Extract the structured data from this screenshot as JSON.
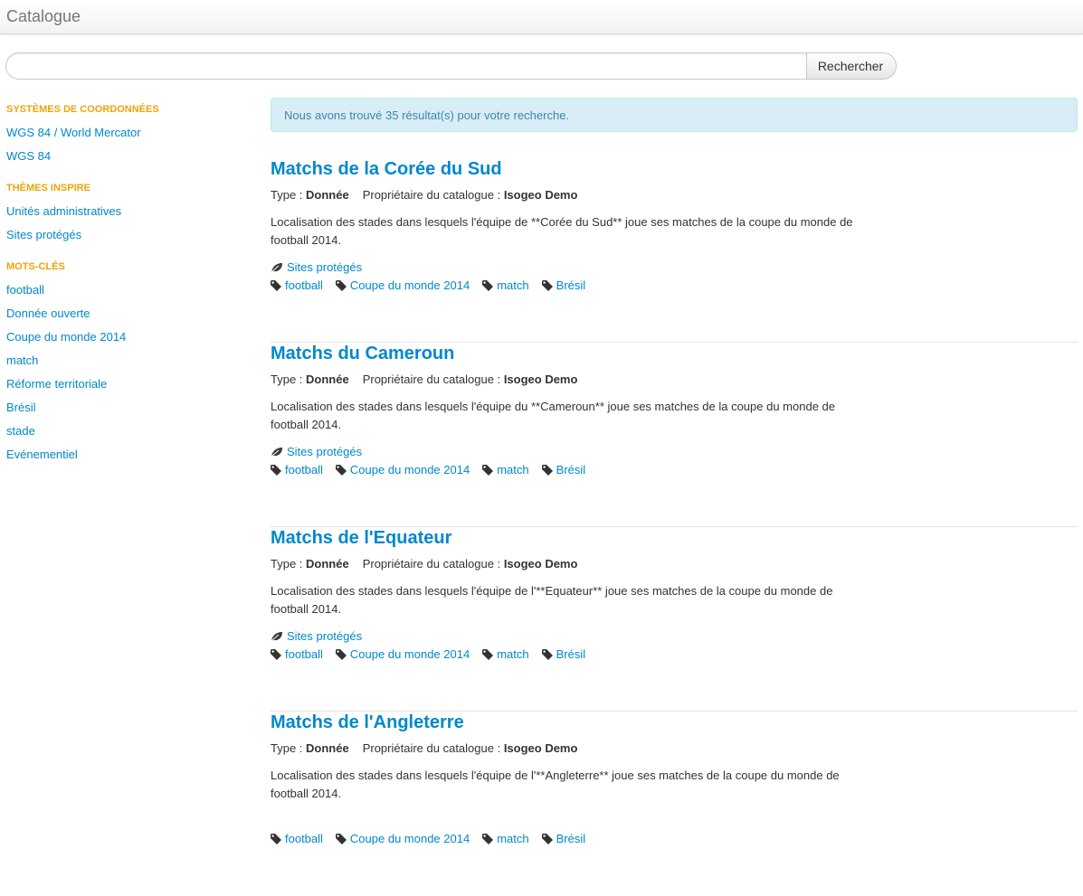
{
  "app": {
    "brand": "Catalogue"
  },
  "search": {
    "value": "",
    "placeholder": "",
    "button_label": "Rechercher"
  },
  "sidebar": {
    "facets": [
      {
        "heading": "Systèmes de coordonnées",
        "items": [
          "WGS 84 / World Mercator",
          "WGS 84"
        ]
      },
      {
        "heading": "Thèmes INSPIRE",
        "items": [
          "Unités administratives",
          "Sites protégés"
        ]
      },
      {
        "heading": "Mots-clés",
        "items": [
          "football",
          "Donnée ouverte",
          "Coupe du monde 2014",
          "match",
          "Réforme territoriale",
          "Brésil",
          "stade",
          "Evénementiel"
        ]
      }
    ]
  },
  "results_alert": "Nous avons trouvé 35 résultat(s) pour votre recherche.",
  "labels": {
    "type_label": "Type : ",
    "owner_label": "Propriétaire du catalogue : "
  },
  "results": [
    {
      "title": "Matchs de la Corée du Sud",
      "type": "Donnée",
      "owner": "Isogeo Demo",
      "description": "Localisation des stades dans lesquels l'équipe de **Corée du Sud** joue ses matches de la coupe du monde de football 2014.",
      "theme": "Sites protégés",
      "tags": [
        "football",
        "Coupe du monde 2014",
        "match",
        "Brésil"
      ]
    },
    {
      "title": "Matchs du Cameroun",
      "type": "Donnée",
      "owner": "Isogeo Demo",
      "description": "Localisation des stades dans lesquels l'équipe du **Cameroun** joue ses matches de la coupe du monde de football 2014.",
      "theme": "Sites protégés",
      "tags": [
        "football",
        "Coupe du monde 2014",
        "match",
        "Brésil"
      ]
    },
    {
      "title": "Matchs de l'Equateur",
      "type": "Donnée",
      "owner": "Isogeo Demo",
      "description": "Localisation des stades dans lesquels l'équipe de l'**Equateur** joue ses matches de la coupe du monde de football 2014.",
      "theme": "Sites protégés",
      "tags": [
        "football",
        "Coupe du monde 2014",
        "match",
        "Brésil"
      ]
    },
    {
      "title": "Matchs de l'Angleterre",
      "type": "Donnée",
      "owner": "Isogeo Demo",
      "description": "Localisation des stades dans lesquels l'équipe de l'**Angleterre** joue ses matches de la coupe du monde de football 2014.",
      "theme": "",
      "tags": [
        "football",
        "Coupe du monde 2014",
        "match",
        "Brésil"
      ]
    }
  ],
  "icons": {
    "theme": "leaf-icon",
    "tag": "tag-icon"
  },
  "colors": {
    "link": "#0088cc",
    "facet_heading": "#f0a30a",
    "alert_bg": "#d9edf7",
    "alert_text": "#3a87ad"
  }
}
